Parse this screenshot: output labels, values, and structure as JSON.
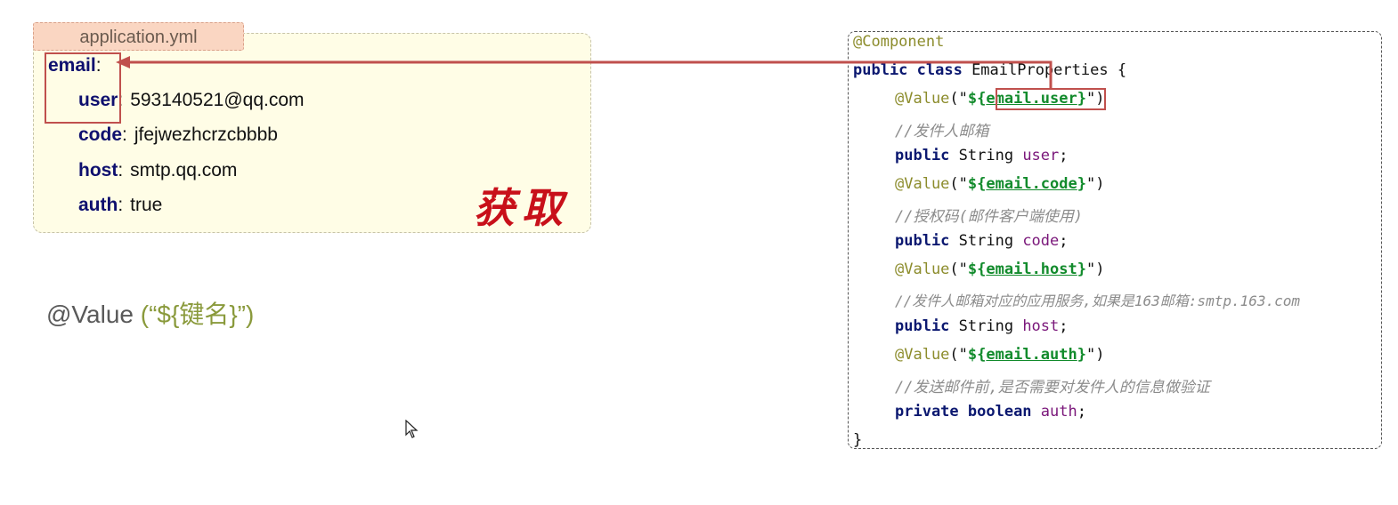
{
  "yaml_panel": {
    "filename": "application.yml",
    "root_key": "email",
    "entries": [
      {
        "key": "user",
        "value": "593140521@qq.com"
      },
      {
        "key": "code",
        "value": "jfejwezhcrzcbbbb"
      },
      {
        "key": "host",
        "value": "smtp.qq.com"
      },
      {
        "key": "auth",
        "value": "true"
      }
    ],
    "stamp_text": "获取",
    "colon": ":"
  },
  "annotation": {
    "prefix": "@Value ",
    "argument": "(“${键名}”)"
  },
  "code_panel": {
    "annotation_component": "@Component",
    "class_decl_kw": "public class ",
    "class_name": "EmailProperties {",
    "fields": [
      {
        "annotation": "@Value",
        "open": "(\"",
        "expr_prefix": "${",
        "key": "email.user",
        "expr_suffix": "}",
        "close": "\")",
        "comment": "//发件人邮箱",
        "modifier": "public",
        "type": " String ",
        "name": "user",
        "semi": ";"
      },
      {
        "annotation": "@Value",
        "open": "(\"",
        "expr_prefix": "${",
        "key": "email.code",
        "expr_suffix": "}",
        "close": "\")",
        "comment": "//授权码(邮件客户端使用)",
        "modifier": "public",
        "type": " String ",
        "name": "code",
        "semi": ";"
      },
      {
        "annotation": "@Value",
        "open": "(\"",
        "expr_prefix": "${",
        "key": "email.host",
        "expr_suffix": "}",
        "close": "\")",
        "comment": "//发件人邮箱对应的应用服务,如果是163邮箱:smtp.163.com",
        "modifier": "public",
        "type": " String ",
        "name": "host",
        "semi": ";"
      },
      {
        "annotation": "@Value",
        "open": "(\"",
        "expr_prefix": "${",
        "key": "email.auth",
        "expr_suffix": "}",
        "close": "\")",
        "comment": "//发送邮件前,是否需要对发件人的信息做验证",
        "modifier": "private",
        "type": " boolean ",
        "name": "auth",
        "semi": ";"
      }
    ],
    "closing_brace": "}"
  },
  "colors": {
    "highlight": "#c0504d",
    "stamp": "#c8101a"
  }
}
